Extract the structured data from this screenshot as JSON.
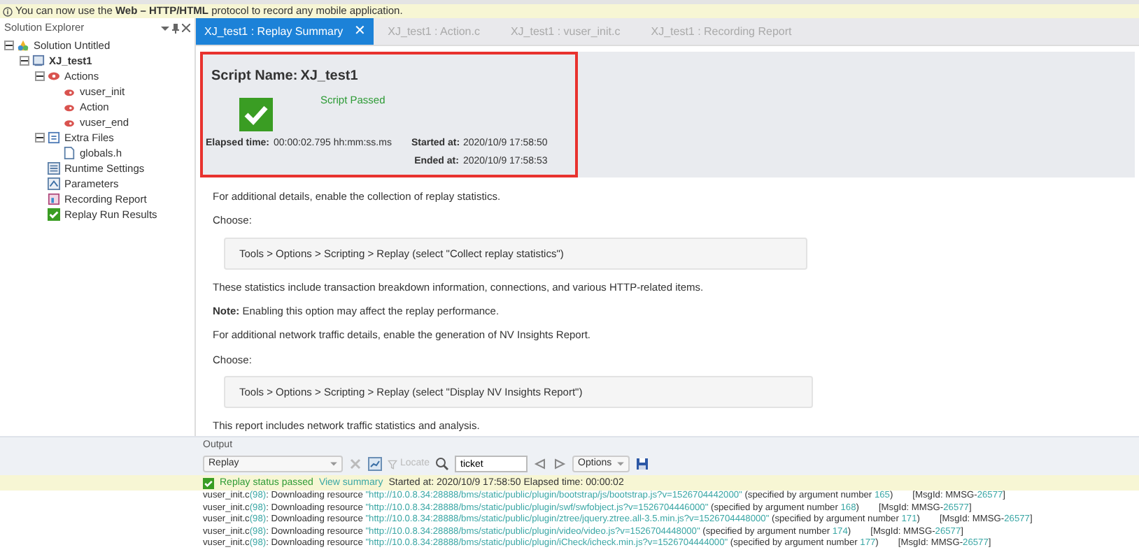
{
  "info_bar": {
    "text": "You can now use the **Web – HTTP/HTML** protocol to record any mobile application."
  },
  "explorer": {
    "title": "Solution Explorer",
    "tree": [
      {
        "label": "Solution Untitled",
        "kind": "solution",
        "expanded": true,
        "children": [
          {
            "label": "XJ_test1",
            "kind": "script",
            "expanded": true,
            "children": [
              {
                "label": "Actions",
                "kind": "actions",
                "expanded": true,
                "children": [
                  {
                    "label": "vuser_init",
                    "kind": "action"
                  },
                  {
                    "label": "Action",
                    "kind": "action"
                  },
                  {
                    "label": "vuser_end",
                    "kind": "action"
                  }
                ]
              },
              {
                "label": "Extra Files",
                "kind": "folder",
                "expanded": true,
                "children": [
                  {
                    "label": "globals.h",
                    "kind": "file"
                  }
                ]
              },
              {
                "label": "Runtime Settings",
                "kind": "settings"
              },
              {
                "label": "Parameters",
                "kind": "params"
              },
              {
                "label": "Recording Report",
                "kind": "report"
              },
              {
                "label": "Replay Run Results",
                "kind": "results"
              }
            ]
          }
        ]
      }
    ]
  },
  "tabs": [
    {
      "label": "XJ_test1 : Replay Summary",
      "selected": true,
      "close": "✕"
    },
    {
      "label": "XJ_test1 : Action.c",
      "selected": false
    },
    {
      "label": "XJ_test1 : vuser_init.c",
      "selected": false
    },
    {
      "label": "XJ_test1 : Recording Report",
      "selected": false
    }
  ],
  "summary": {
    "script_name_label": "Script Name:",
    "script_name": "XJ_test1",
    "status": "Script Passed",
    "elapsed_label": "Elapsed time:",
    "elapsed": "00:00:02.795 hh:mm:ss.ms",
    "started_label": "Started at:",
    "started": "2020/10/9 17:58:50",
    "ended_label": "Ended at:",
    "ended": "2020/10/9 17:58:53"
  },
  "content": [
    {
      "kind": "text",
      "text": "For additional details, enable the collection of replay statistics."
    },
    {
      "kind": "text",
      "text": "Choose:"
    },
    {
      "kind": "command",
      "text": "Tools > Options > Scripting > Replay (select \"Collect replay statistics\")"
    },
    {
      "kind": "text",
      "text": "These statistics include transaction breakdown information, connections, and various HTTP-related items."
    },
    {
      "kind": "text",
      "text": "**Note:** Enabling this option may affect the replay performance."
    },
    {
      "kind": "text",
      "text": "For additional network traffic details, enable the generation of NV Insights Report."
    },
    {
      "kind": "text",
      "text": "Choose:"
    },
    {
      "kind": "command",
      "text": "Tools > Options > Scripting > Replay (select \"Display NV Insights Report\")"
    },
    {
      "kind": "text",
      "text": "This report includes network traffic statistics and analysis."
    }
  ],
  "output": {
    "title": "Output",
    "source": "Replay",
    "search": "ticket",
    "options": "Options",
    "locate": "Locate",
    "status": {
      "passed": "Replay status passed",
      "link": "View summary",
      "details": "Started at: 2020/10/9 17:58:50 Elapsed time: 00:00:02"
    },
    "log": [
      [
        {
          "kind": "plain",
          "text": "vuser_init.c"
        },
        {
          "kind": "link",
          "text": "(98)"
        },
        {
          "kind": "plain",
          "text": ": Downloading resource "
        },
        {
          "kind": "link",
          "text": "\"http://10.0.8.34:28888/bms/static/public/plugin/bootstrap/js/bootstrap.js?v=1526704442000\""
        },
        {
          "kind": "plain",
          "text": " (specified by argument number "
        },
        {
          "kind": "link",
          "text": "165"
        },
        {
          "kind": "plain",
          "text": ")"
        },
        {
          "kind": "msg",
          "text": "[MsgId: MMSG-"
        },
        {
          "kind": "link",
          "text": "26577"
        },
        {
          "kind": "plain",
          "text": "]"
        }
      ],
      [
        {
          "kind": "plain",
          "text": "vuser_init.c"
        },
        {
          "kind": "link",
          "text": "(98)"
        },
        {
          "kind": "plain",
          "text": ": Downloading resource "
        },
        {
          "kind": "link",
          "text": "\"http://10.0.8.34:28888/bms/static/public/plugin/swf/swfobject.js?v=1526704446000\""
        },
        {
          "kind": "plain",
          "text": " (specified by argument number "
        },
        {
          "kind": "link",
          "text": "168"
        },
        {
          "kind": "plain",
          "text": ")"
        },
        {
          "kind": "msg",
          "text": "[MsgId: MMSG-"
        },
        {
          "kind": "link",
          "text": "26577"
        },
        {
          "kind": "plain",
          "text": "]"
        }
      ],
      [
        {
          "kind": "plain",
          "text": "vuser_init.c"
        },
        {
          "kind": "link",
          "text": "(98)"
        },
        {
          "kind": "plain",
          "text": ": Downloading resource "
        },
        {
          "kind": "link",
          "text": "\"http://10.0.8.34:28888/bms/static/public/plugin/ztree/jquery.ztree.all-3.5.min.js?v=1526704448000\""
        },
        {
          "kind": "plain",
          "text": " (specified by argument number "
        },
        {
          "kind": "link",
          "text": "171"
        },
        {
          "kind": "plain",
          "text": ")"
        },
        {
          "kind": "msg",
          "text": "[MsgId: MMSG-"
        },
        {
          "kind": "link",
          "text": "26577"
        },
        {
          "kind": "plain",
          "text": "]"
        }
      ],
      [
        {
          "kind": "plain",
          "text": "vuser_init.c"
        },
        {
          "kind": "link",
          "text": "(98)"
        },
        {
          "kind": "plain",
          "text": ": Downloading resource "
        },
        {
          "kind": "link",
          "text": "\"http://10.0.8.34:28888/bms/static/public/plugin/video/video.js?v=1526704448000\""
        },
        {
          "kind": "plain",
          "text": " (specified by argument number "
        },
        {
          "kind": "link",
          "text": "174"
        },
        {
          "kind": "plain",
          "text": ")"
        },
        {
          "kind": "msg",
          "text": "[MsgId: MMSG-"
        },
        {
          "kind": "link",
          "text": "26577"
        },
        {
          "kind": "plain",
          "text": "]"
        }
      ],
      [
        {
          "kind": "plain",
          "text": "vuser_init.c"
        },
        {
          "kind": "link",
          "text": "(98)"
        },
        {
          "kind": "plain",
          "text": ": Downloading resource "
        },
        {
          "kind": "link",
          "text": "\"http://10.0.8.34:28888/bms/static/public/plugin/iCheck/icheck.min.js?v=1526704444000\""
        },
        {
          "kind": "plain",
          "text": " (specified by argument number "
        },
        {
          "kind": "link",
          "text": "177"
        },
        {
          "kind": "plain",
          "text": ")"
        },
        {
          "kind": "msg",
          "text": "[MsgId: MMSG-"
        },
        {
          "kind": "link",
          "text": "26577"
        },
        {
          "kind": "plain",
          "text": "]"
        }
      ]
    ]
  }
}
